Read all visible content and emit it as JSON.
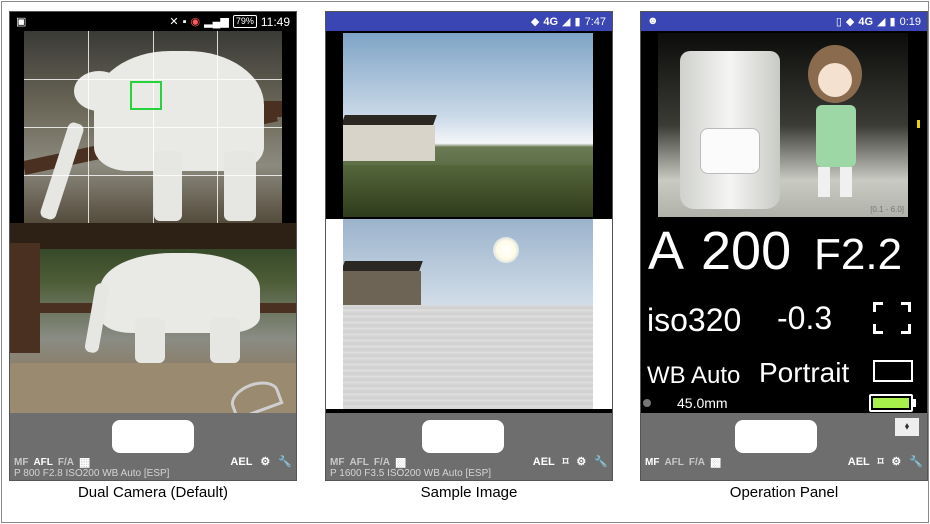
{
  "panels": [
    {
      "caption": "Dual Camera (Default)",
      "status": {
        "time": "11:49",
        "battery": "79%"
      },
      "toolbar": {
        "mf": "MF",
        "afl": "AFL",
        "fa": "F/A",
        "ael": "AEL",
        "info": "P 800 F2.8 ISO200 WB Auto [ESP]"
      }
    },
    {
      "caption": "Sample Image",
      "status": {
        "time": "7:47",
        "network": "4G"
      },
      "toolbar": {
        "mf": "MF",
        "afl": "AFL",
        "fa": "F/A",
        "ael": "AEL",
        "info": "P 1600 F3.5 ISO200 WB Auto [ESP]"
      }
    },
    {
      "caption": "Operation Panel",
      "status": {
        "time": "0:19",
        "network": "4G"
      },
      "toolbar": {
        "mf": "MF",
        "afl": "AFL",
        "fa": "F/A",
        "ael": "AEL"
      },
      "readout": {
        "mode": "A",
        "shutter": "200",
        "aperture": "F2.2",
        "iso": "iso320",
        "exposure": "-0.3",
        "wb": "WB Auto",
        "scene": "Portrait",
        "focal": "45.0mm",
        "photo_tag": "[0.1 - 6.0]"
      }
    }
  ],
  "colors": {
    "accent_blue": "#3946b4",
    "af_box": "#27d33b",
    "battery": "#a7ef4a",
    "bar": "#6e6e6e"
  },
  "icons": [
    "gallery-icon",
    "bluetooth-off-icon",
    "wifi-icon",
    "signal-icon",
    "battery-icon",
    "grid-icon",
    "settings-gear-icon",
    "wrench-icon",
    "bookmark-icon",
    "android-icon",
    "vibrate-icon",
    "pin-icon"
  ]
}
